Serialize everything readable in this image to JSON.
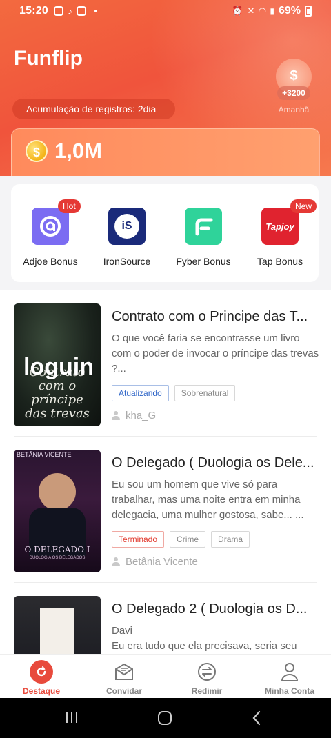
{
  "status_bar": {
    "time": "15:20",
    "battery": "69%"
  },
  "header": {
    "app_title": "Funflip",
    "checkin_text": "Acumulação de registros: 2dia",
    "tomorrow_coin_symbol": "$",
    "tomorrow_amount": "+3200",
    "tomorrow_label": "Amanhã",
    "coin_symbol": "$",
    "balance": "1,0M"
  },
  "offers": [
    {
      "label": "Adjoe Bonus",
      "badge": "Hot",
      "icon": "adjoe-icon",
      "color": "#7b6cf2"
    },
    {
      "label": "IronSource",
      "badge": "",
      "icon": "ironsource-icon",
      "color": "#1a2a7a"
    },
    {
      "label": "Fyber Bonus",
      "badge": "",
      "icon": "fyber-icon",
      "color": "#2fd39a"
    },
    {
      "label": "Tap Bonus",
      "badge": "New",
      "icon": "tapjoy-icon",
      "color": "#e0232f"
    }
  ],
  "offer_logo_text": {
    "ironsource": "iS",
    "tapjoy": "Tapjoy"
  },
  "books": [
    {
      "title": "Contrato com o Principe das T...",
      "description": "O que você faria se encontrasse um livro com o poder de invocar o príncipe das trevas ?...",
      "tags": [
        "Atualizando",
        "Sobrenatural"
      ],
      "author": "kha_G",
      "cover_text": "Contrato com o príncipe das trevas"
    },
    {
      "title": "O Delegado ( Duologia os Dele...",
      "description": "Eu sou um homem que vive só para trabalhar, mas uma noite entra em minha delegacia, uma mulher gostosa, sabe... ...",
      "tags": [
        "Terminado",
        "Crime",
        "Drama"
      ],
      "author": "Betânia Vicente",
      "cover_author": "BETÂNIA VICENTE",
      "cover_text": "O DELEGADO I",
      "cover_sub": "DUOLOGIA OS DELEGADOS"
    },
    {
      "title": "O Delegado 2 ( Duologia os D...",
      "description": "Davi\nEu era tudo que ela precisava, seria seu",
      "tags": [],
      "author": ""
    }
  ],
  "overlay_text": "loguin",
  "bottom_nav": [
    {
      "label": "Destaque",
      "icon": "refresh-icon",
      "active": true
    },
    {
      "label": "Convidar",
      "icon": "envelope-icon",
      "active": false
    },
    {
      "label": "Redimir",
      "icon": "exchange-icon",
      "active": false
    },
    {
      "label": "Minha Conta",
      "icon": "user-icon",
      "active": false
    }
  ]
}
